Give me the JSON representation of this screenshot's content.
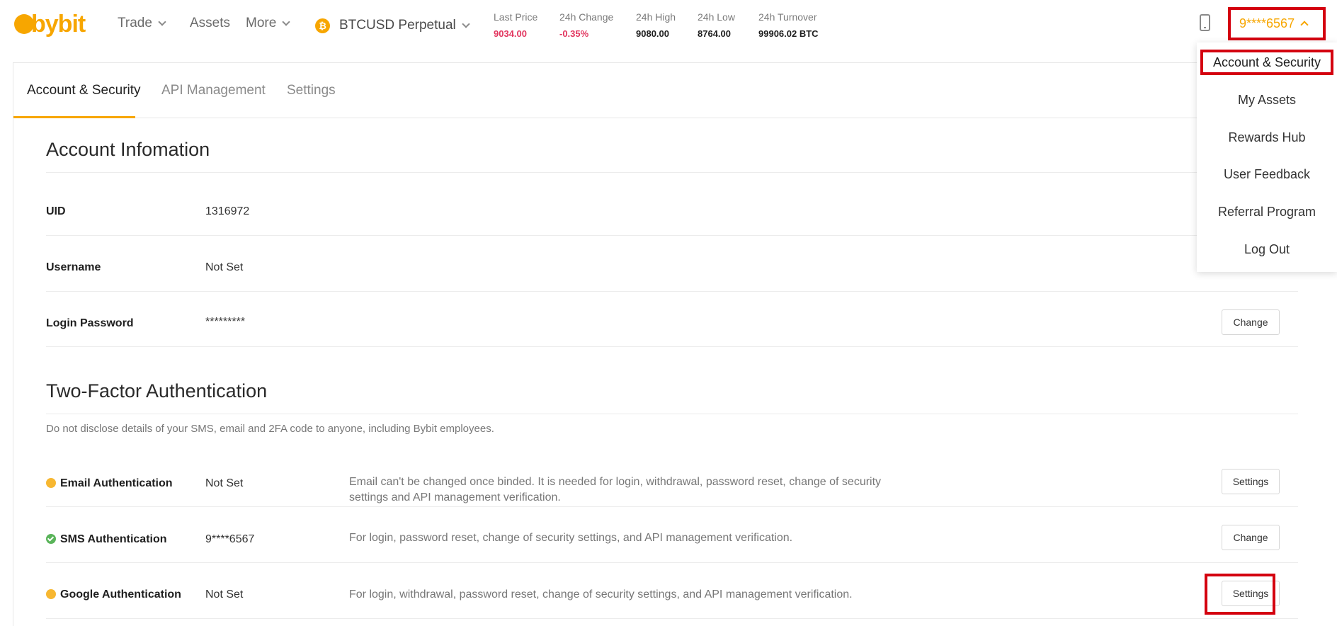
{
  "brand": {
    "logo_text": "bybit",
    "accent": "#f7a600"
  },
  "nav": {
    "trade": "Trade",
    "assets": "Assets",
    "more": "More",
    "symbol": "BTCUSD Perpetual",
    "coin_glyph": "₿"
  },
  "ticker": [
    {
      "label": "Last Price",
      "value": "9034.00",
      "color": "#e2365f"
    },
    {
      "label": "24h Change",
      "value": "-0.35%",
      "color": "#e2365f"
    },
    {
      "label": "24h High",
      "value": "9080.00"
    },
    {
      "label": "24h Low",
      "value": "8764.00"
    },
    {
      "label": "24h Turnover",
      "value": "99906.02 BTC"
    }
  ],
  "user": {
    "masked_id": "9****6567"
  },
  "dropdown": {
    "items": [
      "Account & Security",
      "My Assets",
      "Rewards Hub",
      "User Feedback",
      "Referral Program",
      "Log Out"
    ]
  },
  "tabs": [
    "Account & Security",
    "API Management",
    "Settings"
  ],
  "account_info": {
    "title": "Account Infomation",
    "rows": [
      {
        "label": "UID",
        "value": "1316972"
      },
      {
        "label": "Username",
        "value": "Not Set"
      },
      {
        "label": "Login Password",
        "value": "*********",
        "action": "Change"
      }
    ]
  },
  "two_factor": {
    "title": "Two-Factor Authentication",
    "note": "Do not disclose details of your SMS, email and 2FA code to anyone, including Bybit employees.",
    "rows": [
      {
        "label": "Email Authentication",
        "status": "yellow",
        "value": "Not Set",
        "desc": "Email can't be changed once binded. It is needed for login, withdrawal, password reset, change of security settings and API management verification.",
        "action": "Settings"
      },
      {
        "label": "SMS Authentication",
        "status": "green",
        "value": "9****6567",
        "desc": "For login, password reset, change of security settings, and API management verification.",
        "action": "Change"
      },
      {
        "label": "Google Authentication",
        "status": "yellow",
        "value": "Not Set",
        "desc": "For login, withdrawal, password reset, change of security settings, and API management verification.",
        "action": "Settings"
      }
    ]
  }
}
